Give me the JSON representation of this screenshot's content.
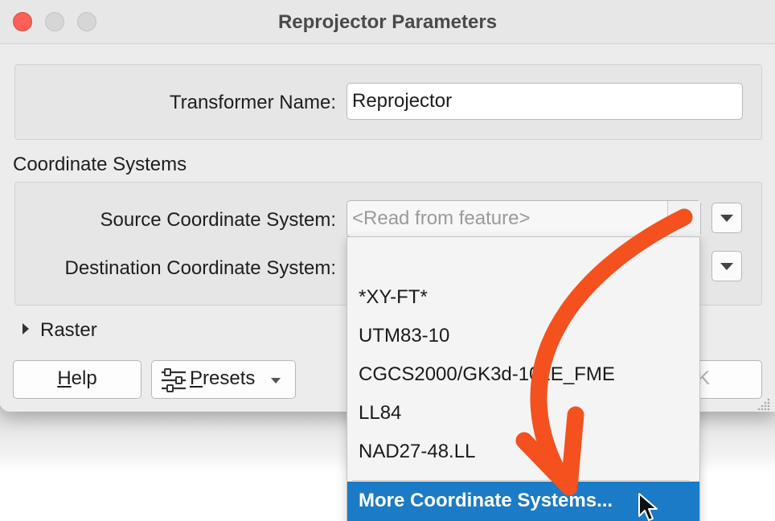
{
  "window": {
    "title": "Reprojector Parameters"
  },
  "transformer": {
    "name_label": "Transformer Name:",
    "name_value": "Reprojector"
  },
  "coordinate_systems": {
    "section_title": "Coordinate Systems",
    "source_label": "Source Coordinate System:",
    "source_placeholder": "<Read from feature>",
    "destination_label": "Destination Coordinate System:"
  },
  "raster": {
    "label": "Raster"
  },
  "buttons": {
    "help_prefix": "",
    "help_mnemonic": "H",
    "help_rest": "elp",
    "presets_mnemonic": "P",
    "presets_rest": "resets",
    "ok_partial": "K"
  },
  "dropdown": {
    "items": [
      "",
      "*XY-FT*",
      "UTM83-10",
      "CGCS2000/GK3d-102E_FME",
      "LL84",
      "NAD27-48.LL"
    ],
    "highlighted": "More Coordinate Systems..."
  },
  "colors": {
    "annotation_arrow": "#f4511e",
    "highlight": "#1b7bc6",
    "close_button": "#fe5f57"
  },
  "icons": {
    "presets": "sliders-icon",
    "cursor": "mouse-pointer-icon"
  }
}
